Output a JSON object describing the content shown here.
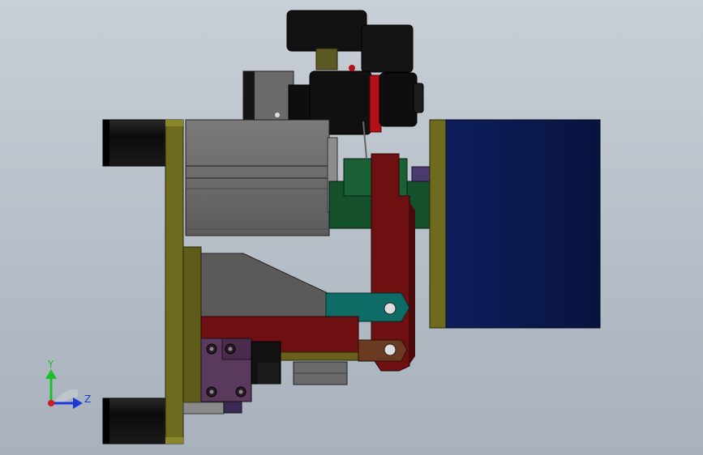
{
  "triad": {
    "y_label": "Y",
    "z_label": "Z",
    "y_color": "#1fbf2a",
    "z_color": "#1a3ad6",
    "x_color": "#d41a1a"
  },
  "colors": {
    "background_top": "#c9cfd6",
    "plate_olive": "#6f6b1e",
    "motor_gray": "#6f6f6f",
    "dark_block_navy": "#0c1a4d",
    "red_part": "#6e0f12",
    "teal_part": "#0d6d66",
    "green_part": "#14502a",
    "purple_part": "#5a3a5c",
    "brown_part": "#6b3a22",
    "black_part": "#151515",
    "accent_red": "#b3101a"
  }
}
